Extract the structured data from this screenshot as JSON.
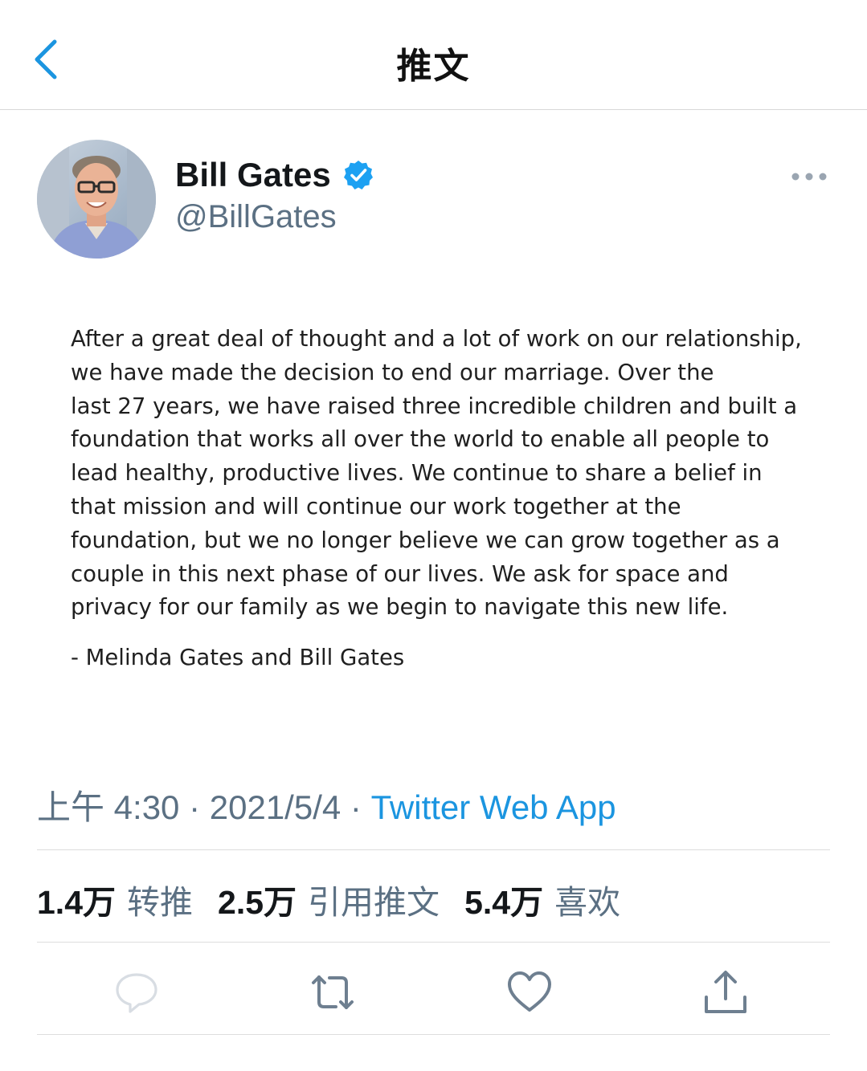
{
  "nav": {
    "back_icon": "chevron-left-icon",
    "title": "推文"
  },
  "author": {
    "name": "Bill Gates",
    "handle": "@BillGates",
    "verified_icon": "verified-badge-icon",
    "more_icon": "more-horizontal-icon"
  },
  "tweet": {
    "text": "After a great deal of thought and a lot of work on our relationship,\nwe have made the decision to end our marriage. Over the\nlast 27 years, we have raised three incredible children and built a\nfoundation that works all over the world to enable all people to\nlead healthy, productive lives. We continue to share a belief in\nthat mission and will continue our work together at the\nfoundation, but we no longer believe we can grow together as a\ncouple in this next phase of our lives. We ask for space and\nprivacy for our family as we begin to navigate this new life.",
    "signature": "- Melinda Gates and Bill Gates"
  },
  "meta": {
    "time": "上午 4:30",
    "separator": " · ",
    "date": "2021/5/4",
    "source": "Twitter Web App"
  },
  "stats": [
    {
      "count": "1.4",
      "unit": "万",
      "label": "转推"
    },
    {
      "count": "2.5",
      "unit": "万",
      "label": "引用推文"
    },
    {
      "count": "5.4",
      "unit": "万",
      "label": "喜欢"
    }
  ],
  "actions": [
    {
      "icon": "reply-icon"
    },
    {
      "icon": "retweet-icon"
    },
    {
      "icon": "like-icon"
    },
    {
      "icon": "share-icon"
    }
  ],
  "colors": {
    "accent": "#1b95e0",
    "secondary_text": "#5b7083",
    "primary_text": "#14171a",
    "divider": "#dddddd"
  }
}
